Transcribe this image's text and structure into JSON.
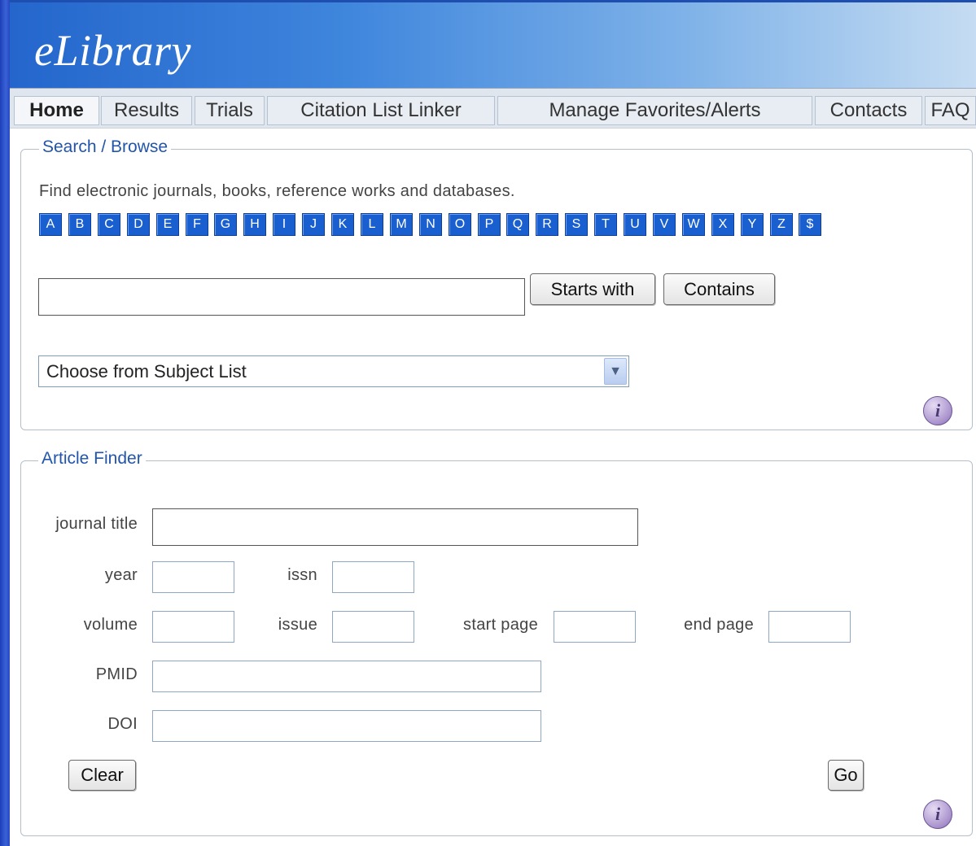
{
  "app": {
    "logo": "eLibrary"
  },
  "nav": {
    "tabs": [
      {
        "label": "Home",
        "active": true
      },
      {
        "label": "Results",
        "active": false
      },
      {
        "label": "Trials",
        "active": false
      },
      {
        "label": "Citation List Linker",
        "active": false
      },
      {
        "label": "Manage Favorites/Alerts",
        "active": false
      },
      {
        "label": "Contacts",
        "active": false
      },
      {
        "label": "FAQ",
        "active": false
      }
    ]
  },
  "search": {
    "legend": "Search / Browse",
    "description": "Find electronic journals, books, reference works and databases.",
    "letters": [
      "A",
      "B",
      "C",
      "D",
      "E",
      "F",
      "G",
      "H",
      "I",
      "J",
      "K",
      "L",
      "M",
      "N",
      "O",
      "P",
      "Q",
      "R",
      "S",
      "T",
      "U",
      "V",
      "W",
      "X",
      "Y",
      "Z",
      "$"
    ],
    "query_value": "",
    "starts_with_label": "Starts with",
    "contains_label": "Contains",
    "subject_select": "Choose from Subject List",
    "info_glyph": "i"
  },
  "article": {
    "legend": "Article Finder",
    "journal_title_label": "journal title",
    "year_label": "year",
    "issn_label": "issn",
    "volume_label": "volume",
    "issue_label": "issue",
    "start_page_label": "start page",
    "end_page_label": "end page",
    "pmid_label": "PMID",
    "doi_label": "DOI",
    "clear_label": "Clear",
    "go_label": "Go",
    "info_glyph": "i"
  },
  "colors": {
    "header_start": "#2466cc",
    "header_end": "#c5dcf2",
    "letter_button": "#1a5fd0",
    "legend_text": "#2255aa"
  }
}
